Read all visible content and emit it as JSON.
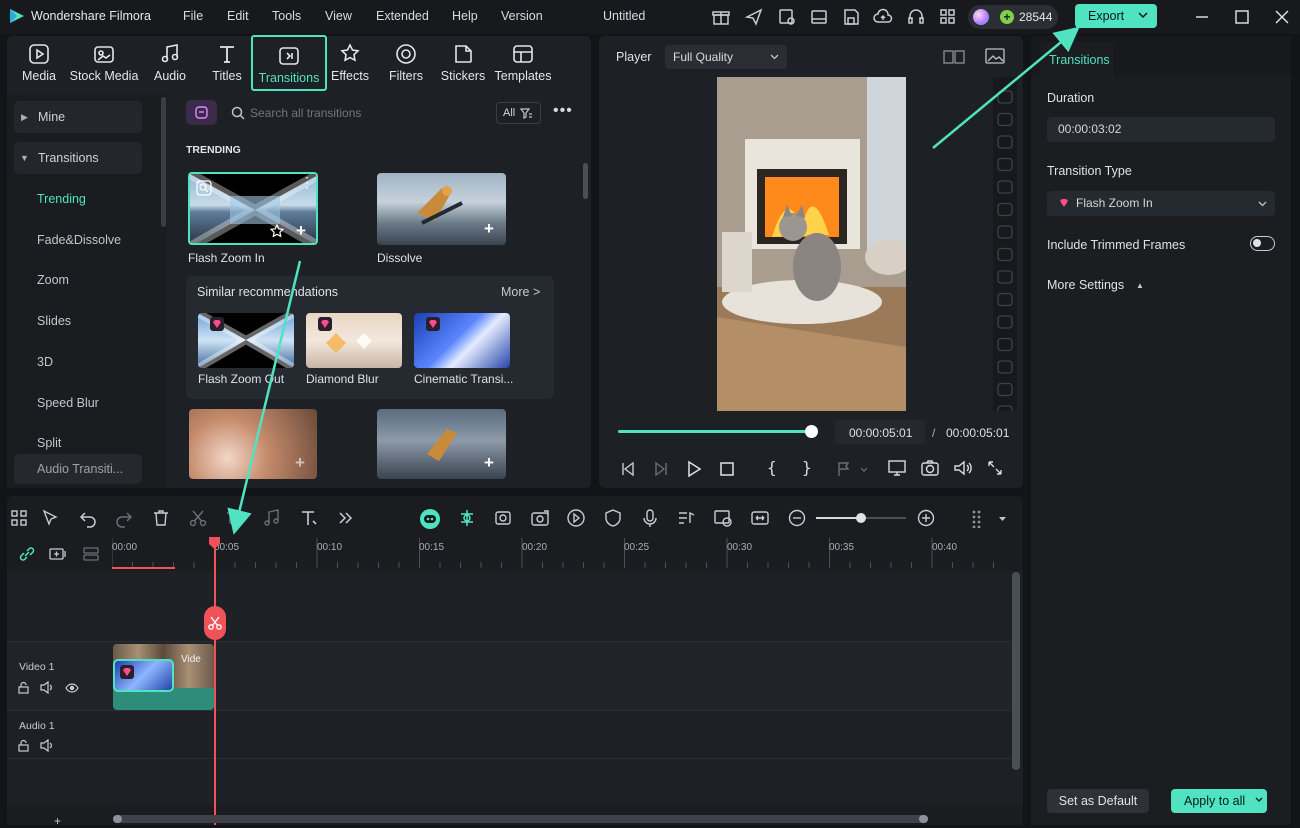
{
  "app": {
    "name": "Wondershare Filmora",
    "project_title": "Untitled",
    "credits": "28544",
    "export_label": "Export",
    "menu": [
      "File",
      "Edit",
      "Tools",
      "View",
      "Extended",
      "Help",
      "Version"
    ]
  },
  "toolbar_tabs": [
    {
      "label": "Media",
      "icon": "media-icon"
    },
    {
      "label": "Stock Media",
      "icon": "stock-media-icon"
    },
    {
      "label": "Audio",
      "icon": "audio-icon"
    },
    {
      "label": "Titles",
      "icon": "titles-icon"
    },
    {
      "label": "Transitions",
      "icon": "transitions-icon",
      "active": true
    },
    {
      "label": "Effects",
      "icon": "effects-icon"
    },
    {
      "label": "Filters",
      "icon": "filters-icon"
    },
    {
      "label": "Stickers",
      "icon": "stickers-icon"
    },
    {
      "label": "Templates",
      "icon": "templates-icon"
    }
  ],
  "sidebar": {
    "mine": "Mine",
    "transitions": "Transitions",
    "items": [
      "Trending",
      "Fade&Dissolve",
      "Zoom",
      "Slides",
      "3D",
      "Speed Blur",
      "Split",
      "Audio Transiti..."
    ],
    "selected": "Trending"
  },
  "library": {
    "search_placeholder": "Search all transitions",
    "filter_label": "All",
    "section_title": "TRENDING",
    "items": [
      {
        "label": "Flash Zoom In"
      },
      {
        "label": "Dissolve"
      }
    ],
    "similar": {
      "title": "Similar recommendations",
      "more": "More >",
      "items": [
        "Flash Zoom Out",
        "Diamond Blur",
        "Cinematic Transi..."
      ]
    }
  },
  "player": {
    "label": "Player",
    "quality": "Full Quality",
    "current_time": "00:00:05:01",
    "separator": "/",
    "total_time": "00:00:05:01",
    "progress": 1.0
  },
  "timeline": {
    "ruler": [
      "00:00",
      "00:05",
      "00:10",
      "00:15",
      "00:20",
      "00:25",
      "00:30",
      "00:35",
      "00:40"
    ],
    "tracks": [
      {
        "name": "Video 1"
      },
      {
        "name": "Audio 1"
      }
    ],
    "clip_label": "Vide",
    "zoom_level": 0.5
  },
  "properties": {
    "tab": "Transitions",
    "duration_label": "Duration",
    "duration_value": "00:00:03:02",
    "type_label": "Transition Type",
    "type_value": "Flash Zoom In",
    "include_trimmed": "Include Trimmed Frames",
    "include_trimmed_on": false,
    "more_settings": "More Settings",
    "set_default": "Set as Default",
    "apply_all": "Apply to all"
  },
  "colors": {
    "accent": "#4fe3c1",
    "playhead": "#f0525a",
    "premium": "#ff4d8d",
    "bg": "#121417",
    "panel": "#1d2025"
  }
}
